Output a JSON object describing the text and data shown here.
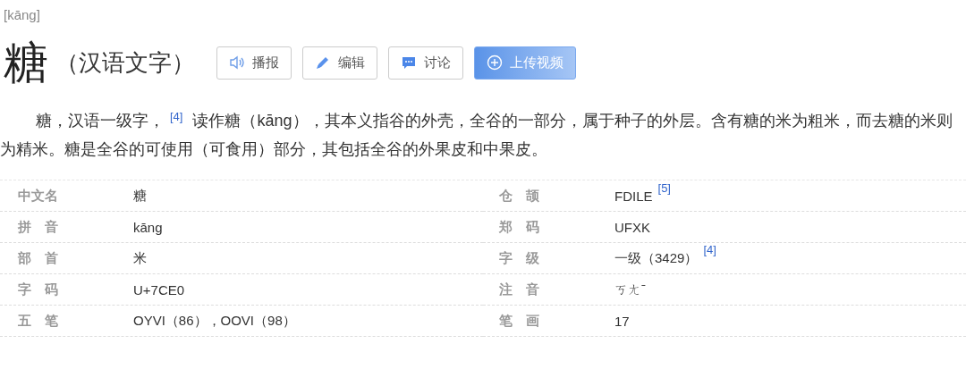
{
  "pinyin": "[kāng]",
  "title": "糖",
  "subtitle": "（汉语文字）",
  "buttons": [
    {
      "kind": "speaker",
      "label": "播报"
    },
    {
      "kind": "pencil",
      "label": "编辑"
    },
    {
      "kind": "chat",
      "label": "讨论"
    },
    {
      "kind": "primary",
      "label": "上传视频"
    }
  ],
  "summary": [
    {
      "text": "糖，汉语一级字，"
    },
    {
      "ref": "[4]"
    },
    {
      "text": " 读作糖（kāng），其本义指谷的外壳，全谷的一部分，属于种子的外层。含有糖的米为粗米，而去糖的米则为精米。糖是全谷的可使用（可食用）部分，其包括全谷的外果皮和中果皮。"
    }
  ],
  "info_left": [
    {
      "label": "中文名",
      "value": "糖"
    },
    {
      "label": "拼音",
      "value": "kāng"
    },
    {
      "label": "部首",
      "value": "米"
    },
    {
      "label": "字码",
      "value": "U+7CE0"
    },
    {
      "label": "五笔",
      "value": "OYVI（86），OOVI（98）"
    }
  ],
  "info_right": [
    {
      "label": "仓颉",
      "value": "FDILE",
      "ref": "[5]"
    },
    {
      "label": "郑码",
      "value": "UFXK"
    },
    {
      "label": "字级",
      "value": "一级（3429）",
      "ref": "[4]"
    },
    {
      "label": "注音",
      "value": "ㄎㄤˉ"
    },
    {
      "label": "笔画",
      "value": "17"
    }
  ]
}
